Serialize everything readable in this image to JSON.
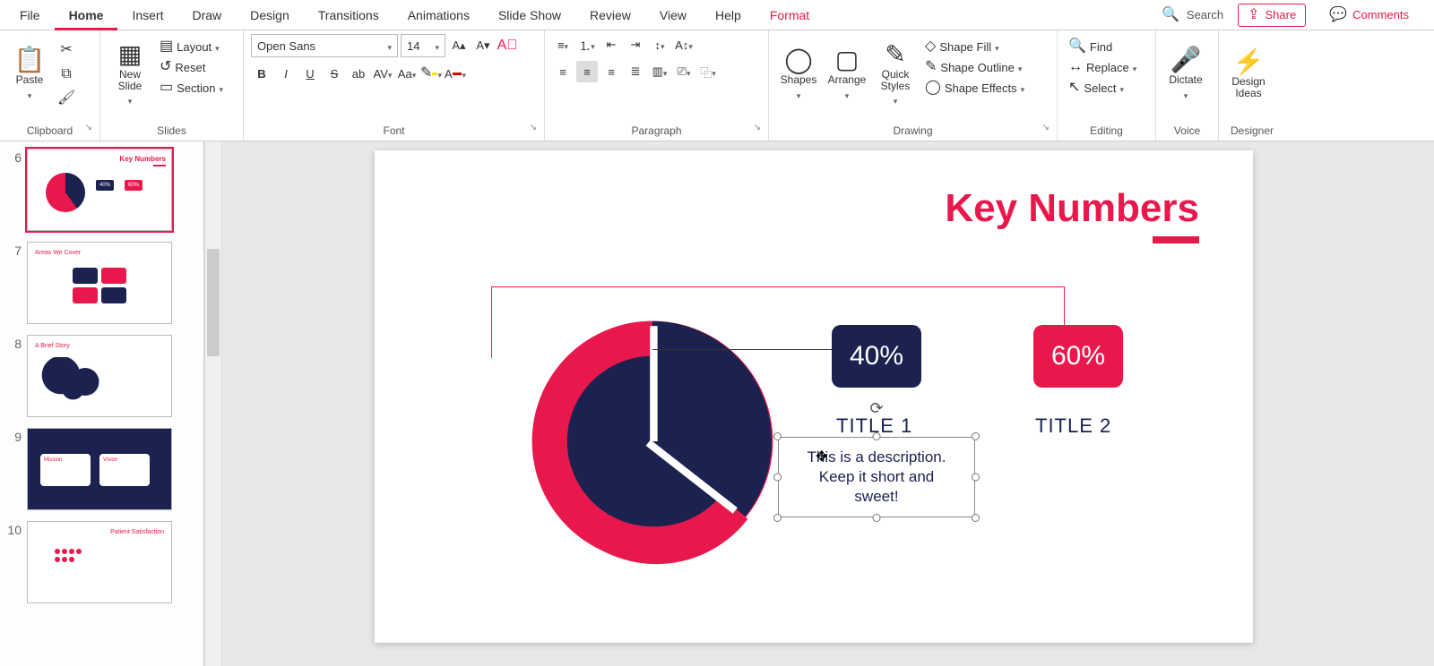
{
  "tabs": {
    "items": [
      "File",
      "Home",
      "Insert",
      "Draw",
      "Design",
      "Transitions",
      "Animations",
      "Slide Show",
      "Review",
      "View",
      "Help",
      "Format"
    ],
    "active": "Home",
    "format": "Format",
    "search": "Search",
    "share": "Share",
    "comments": "Comments"
  },
  "ribbon": {
    "clipboard": {
      "paste": "Paste",
      "label": "Clipboard"
    },
    "slides": {
      "new_slide": "New\nSlide",
      "layout": "Layout",
      "reset": "Reset",
      "section": "Section",
      "label": "Slides"
    },
    "font": {
      "name": "Open Sans",
      "size": "14",
      "label": "Font"
    },
    "paragraph": {
      "label": "Paragraph"
    },
    "drawing": {
      "shapes": "Shapes",
      "arrange": "Arrange",
      "quick": "Quick\nStyles",
      "fill": "Shape Fill",
      "outline": "Shape Outline",
      "effects": "Shape Effects",
      "label": "Drawing"
    },
    "editing": {
      "find": "Find",
      "replace": "Replace",
      "select": "Select",
      "label": "Editing"
    },
    "voice": {
      "dictate": "Dictate",
      "label": "Voice"
    },
    "designer": {
      "ideas": "Design\nIdeas",
      "label": "Designer"
    }
  },
  "thumbs": [
    {
      "n": "6",
      "title": "Key Numbers"
    },
    {
      "n": "7",
      "title": "Areas We Cover"
    },
    {
      "n": "8",
      "title": "A Brief Story"
    },
    {
      "n": "9",
      "title": ""
    },
    {
      "n": "10",
      "title": "Patient Satisfaction"
    }
  ],
  "slide": {
    "title": "Key Numbers",
    "pct1": "40%",
    "pct2": "60%",
    "t1": "TITLE 1",
    "t2": "TITLE 2",
    "desc": "This is a description.\nKeep it short and\nsweet!"
  },
  "chart_data": {
    "type": "pie",
    "title": "Key Numbers",
    "series": [
      {
        "name": "TITLE 1",
        "value": 40,
        "color": "#1b2250"
      },
      {
        "name": "TITLE 2",
        "value": 60,
        "color": "#e9184c"
      }
    ]
  }
}
